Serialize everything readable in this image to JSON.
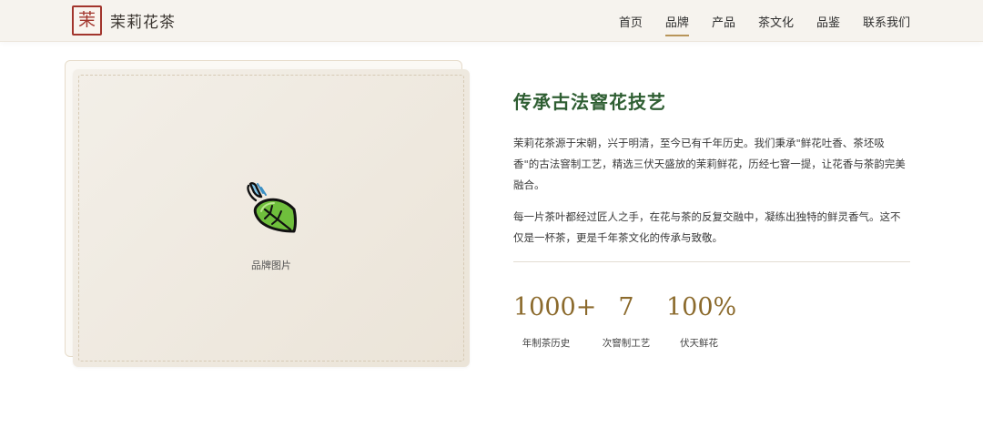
{
  "brand": {
    "seal_char": "茉",
    "name": "茉莉花茶"
  },
  "nav": {
    "items": [
      {
        "label": "首页"
      },
      {
        "label": "品牌"
      },
      {
        "label": "产品"
      },
      {
        "label": "茶文化"
      },
      {
        "label": "品鉴"
      },
      {
        "label": "联系我们"
      }
    ],
    "active": "品牌"
  },
  "image": {
    "caption": "品牌图片",
    "icon": "leaf-icon"
  },
  "content": {
    "title": "传承古法窨花技艺",
    "paragraphs": [
      "茉莉花茶源于宋朝，兴于明清，至今已有千年历史。我们秉承\"鲜花吐香、茶坯吸香\"的古法窨制工艺，精选三伏天盛放的茉莉鲜花，历经七窨一提，让花香与茶韵完美融合。",
      "每一片茶叶都经过匠人之手，在花与茶的反复交融中，凝练出独特的鲜灵香气。这不仅是一杯茶，更是千年茶文化的传承与致敬。"
    ]
  },
  "stats": [
    {
      "value": "1000+",
      "label": "年制茶历史"
    },
    {
      "value": "7",
      "label": "次窨制工艺"
    },
    {
      "value": "100%",
      "label": "伏天鲜花"
    }
  ],
  "colors": {
    "accent_gold": "#8b6a2c",
    "title_green": "#2e5e32",
    "seal_red": "#a2352d",
    "nav_underline": "#b8955a"
  }
}
